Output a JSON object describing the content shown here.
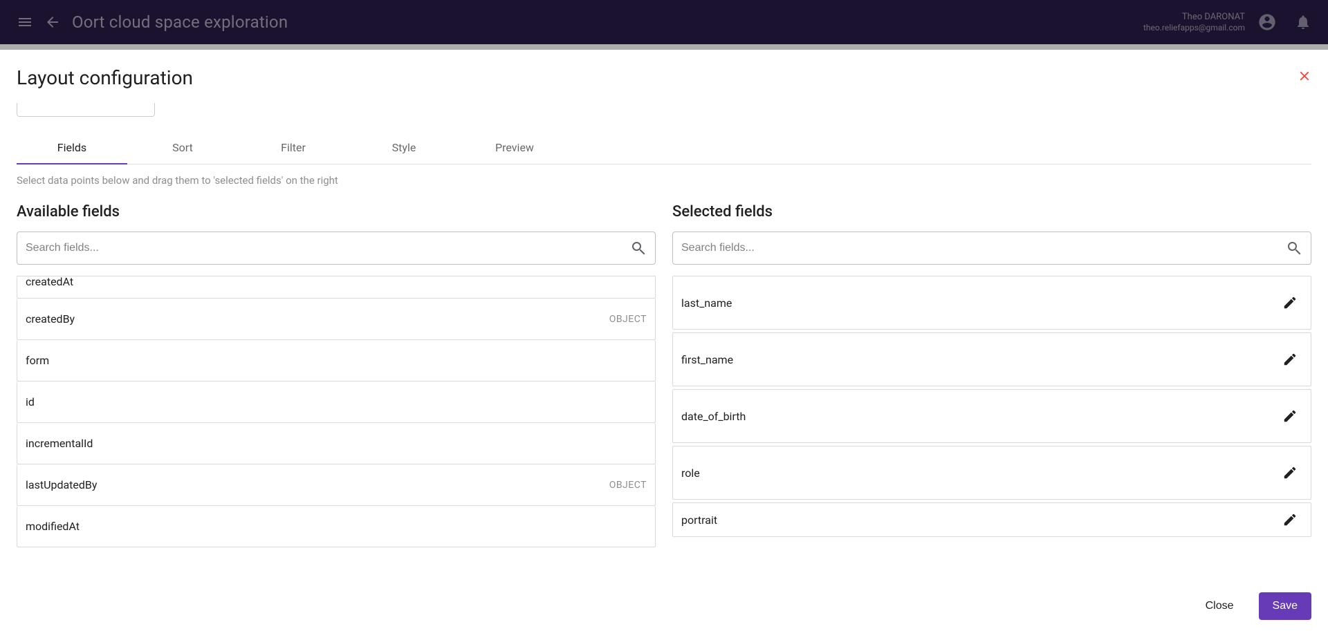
{
  "header": {
    "app_title": "Oort cloud space exploration",
    "user_name": "Theo DARONAT",
    "user_email": "theo.reliefapps@gmail.com"
  },
  "dialog": {
    "title": "Layout configuration",
    "helper_text": "Select data points below and drag them to 'selected fields' on the right",
    "tabs": {
      "fields": "Fields",
      "sort": "Sort",
      "filter": "Filter",
      "style": "Style",
      "preview": "Preview"
    },
    "available": {
      "title": "Available fields",
      "search_placeholder": "Search fields...",
      "items": [
        {
          "label": "createdAt",
          "type": ""
        },
        {
          "label": "createdBy",
          "type": "OBJECT"
        },
        {
          "label": "form",
          "type": ""
        },
        {
          "label": "id",
          "type": ""
        },
        {
          "label": "incrementalId",
          "type": ""
        },
        {
          "label": "lastUpdatedBy",
          "type": "OBJECT"
        },
        {
          "label": "modifiedAt",
          "type": ""
        }
      ]
    },
    "selected": {
      "title": "Selected fields",
      "search_placeholder": "Search fields...",
      "items": [
        {
          "label": "last_name"
        },
        {
          "label": "first_name"
        },
        {
          "label": "date_of_birth"
        },
        {
          "label": "role"
        },
        {
          "label": "portrait"
        }
      ]
    },
    "buttons": {
      "close": "Close",
      "save": "Save"
    }
  }
}
